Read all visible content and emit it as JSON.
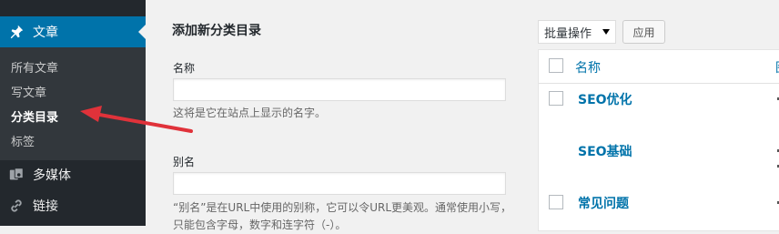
{
  "sidebar": {
    "posts_label": "文章",
    "submenu": [
      "所有文章",
      "写文章",
      "分类目录",
      "标签"
    ],
    "media_label": "多媒体",
    "links_label": "链接"
  },
  "form": {
    "title": "添加新分类目录",
    "name_label": "名称",
    "name_value": "",
    "name_help": "这将是它在站点上显示的名字。",
    "slug_label": "别名",
    "slug_value": "",
    "slug_help": "“别名”是在URL中使用的别称，它可以令URL更美观。通常使用小写，只能包含字母，数字和连字符（-）。"
  },
  "table": {
    "bulk_action": "批量操作",
    "apply_label": "应用",
    "header_name": "名称",
    "header_next": "图",
    "rows": [
      "SEO优化",
      "SEO基础",
      "常见问题"
    ]
  },
  "colors": {
    "sidebar_bg": "#23282d",
    "submenu_bg": "#32373c",
    "active_bg": "#0073aa",
    "link": "#0073aa",
    "annotation_arrow": "#e0323a"
  },
  "icons": {
    "posts": "pushpin-icon",
    "media": "media-icon",
    "links": "link-icon"
  }
}
